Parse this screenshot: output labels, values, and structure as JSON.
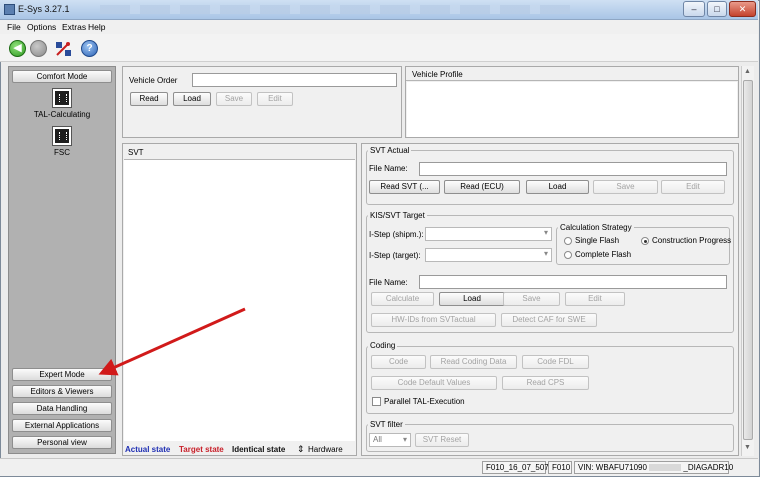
{
  "window": {
    "title": "E-Sys 3.27.1",
    "controls": [
      "–",
      "□",
      "✕"
    ]
  },
  "menu": [
    "File",
    "Options",
    "Extras",
    "Help"
  ],
  "toolbar": {
    "icons": [
      "green-back-icon",
      "gray-stop-icon",
      "connect-icon",
      "help-icon"
    ]
  },
  "sidebar": {
    "top_button": "Comfort Mode",
    "items": [
      {
        "label": "TAL-Calculating",
        "icon": "chip-icon"
      },
      {
        "label": "FSC",
        "icon": "chip-icon"
      }
    ],
    "bottom_buttons": [
      "Expert Mode",
      "Editors & Viewers",
      "Data Handling",
      "External Applications",
      "Personal view"
    ]
  },
  "vehicle_order": {
    "label": "Vehicle Order",
    "value": "",
    "buttons": [
      "Read",
      "Load",
      "Save",
      "Edit"
    ]
  },
  "vehicle_profile": {
    "title": "Vehicle Profile"
  },
  "svt": {
    "title": "SVT",
    "legend": {
      "actual": "Actual state",
      "target": "Target state",
      "identical": "Identical state",
      "hardware": "Hardware"
    },
    "colors": {
      "actual": "#1f2fb3",
      "target": "#c8202a",
      "identical": "#111111"
    }
  },
  "svt_actual": {
    "title": "SVT Actual",
    "file_label": "File Name:",
    "buttons": [
      "Read SVT (...",
      "Read (ECU)",
      "Load",
      "Save",
      "Edit"
    ]
  },
  "kis_target": {
    "title": "KIS/SVT Target",
    "istep_shipm": "I-Step (shipm.):",
    "istep_target": "I-Step (target):",
    "strategy": {
      "title": "Calculation Strategy",
      "options": [
        "Single Flash",
        "Construction Progress",
        "Complete Flash"
      ],
      "selected": "Construction Progress"
    },
    "file_label": "File Name:",
    "buttons": [
      "Calculate",
      "Load",
      "Save",
      "Edit"
    ],
    "buttons2": [
      "HW-IDs from SVTactual",
      "Detect CAF for SWE"
    ]
  },
  "coding": {
    "title": "Coding",
    "row1": [
      "Code",
      "Read Coding Data",
      "Code FDL"
    ],
    "row2": [
      "Code Default Values",
      "Read CPS"
    ],
    "parallel": "Parallel TAL-Execution"
  },
  "svt_filter": {
    "title": "SVT filter",
    "select": "All",
    "reset": "SVT Reset"
  },
  "statusbar": {
    "cells": [
      "F010_16_07_507",
      "F010",
      "VIN: WBAFU71090",
      "_DIAGADR10"
    ]
  }
}
